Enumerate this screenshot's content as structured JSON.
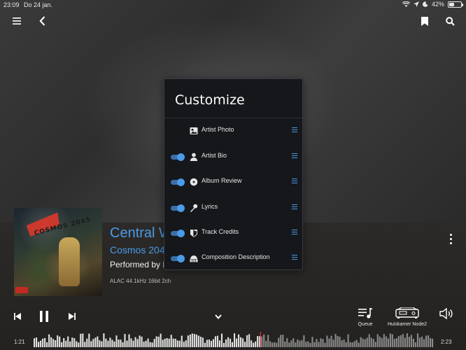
{
  "statusbar": {
    "time": "23:09",
    "date": "Do 24 jan.",
    "battery": "42%",
    "battery_level": 0.42,
    "icons": [
      "wifi-icon",
      "location-icon",
      "moon-icon",
      "battery-icon"
    ]
  },
  "topnav": {
    "left": [
      "hamburger-menu-icon",
      "back-chevron-icon"
    ],
    "right": [
      "bookmark-icon",
      "search-icon"
    ]
  },
  "now_playing": {
    "title": "Central W",
    "album": "Cosmos 204",
    "performer": "Performed by E",
    "format": "ALAC 44.1kHz 16bit 2ch",
    "album_art_text": "COSMOS 2045",
    "accent_color": "#4a9be8"
  },
  "customize": {
    "title": "Customize",
    "rows": [
      {
        "label": "Artist Photo",
        "icon": "photo-icon",
        "toggle": null
      },
      {
        "label": "Artist Bio",
        "icon": "person-icon",
        "toggle": true
      },
      {
        "label": "Album Review",
        "icon": "disc-icon",
        "toggle": true
      },
      {
        "label": "Lyrics",
        "icon": "microphone-icon",
        "toggle": true
      },
      {
        "label": "Track Credits",
        "icon": "credits-icon",
        "toggle": true
      },
      {
        "label": "Composition Description",
        "icon": "piano-icon",
        "toggle": true
      }
    ]
  },
  "transport": {
    "previous": "previous-icon",
    "pause": "pause-icon",
    "next": "next-icon",
    "expand": "chevron-down-icon",
    "queue_label": "Queue",
    "zone_label": "Huiskamer Node2",
    "volume": "volume-icon"
  },
  "progress": {
    "elapsed": "1:21",
    "total": "2:23",
    "fraction": 0.566
  }
}
